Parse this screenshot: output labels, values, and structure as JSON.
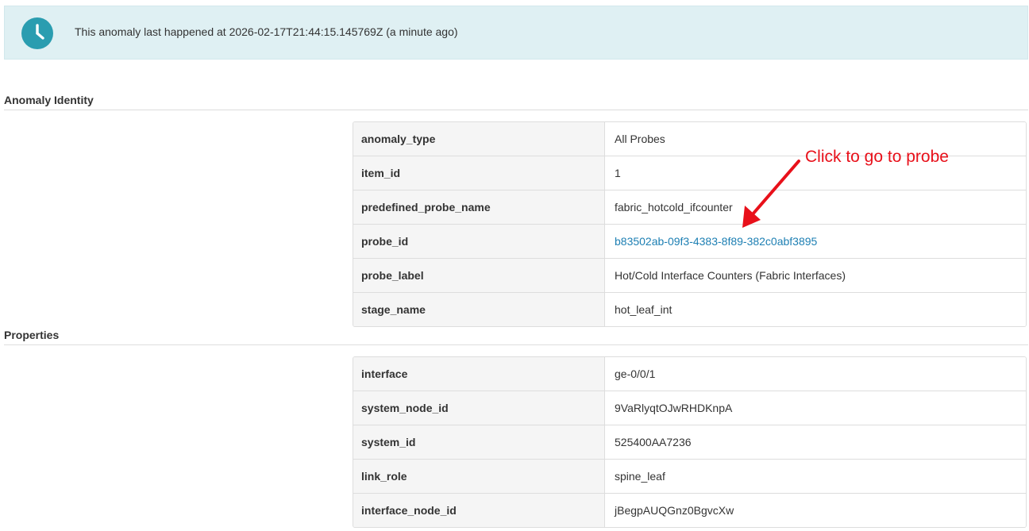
{
  "banner": {
    "icon": "clock-icon",
    "text": "This anomaly last happened at 2026-02-17T21:44:15.145769Z (a minute ago)",
    "background": "#dff0f3",
    "icon_color": "#2a9db0"
  },
  "sections": {
    "identity": {
      "title": "Anomaly Identity",
      "rows": [
        {
          "key": "anomaly_type",
          "value": "All Probes"
        },
        {
          "key": "item_id",
          "value": "1"
        },
        {
          "key": "predefined_probe_name",
          "value": "fabric_hotcold_ifcounter"
        },
        {
          "key": "probe_id",
          "value": "b83502ab-09f3-4383-8f89-382c0abf3895"
        },
        {
          "key": "probe_label",
          "value": "Hot/Cold Interface Counters (Fabric Interfaces)"
        },
        {
          "key": "stage_name",
          "value": "hot_leaf_int"
        }
      ]
    },
    "properties": {
      "title": "Properties",
      "rows": [
        {
          "key": "interface",
          "value": "ge-0/0/1"
        },
        {
          "key": "system_node_id",
          "value": "9VaRlyqtOJwRHDKnpA"
        },
        {
          "key": "system_id",
          "value": "525400AA7236"
        },
        {
          "key": "link_role",
          "value": "spine_leaf"
        },
        {
          "key": "interface_node_id",
          "value": "jBegpAUQGnz0BgvcXw"
        }
      ]
    }
  },
  "annotation": {
    "text": "Click to go to probe",
    "color": "#e8101a"
  },
  "link_color": "#1d7fb3"
}
